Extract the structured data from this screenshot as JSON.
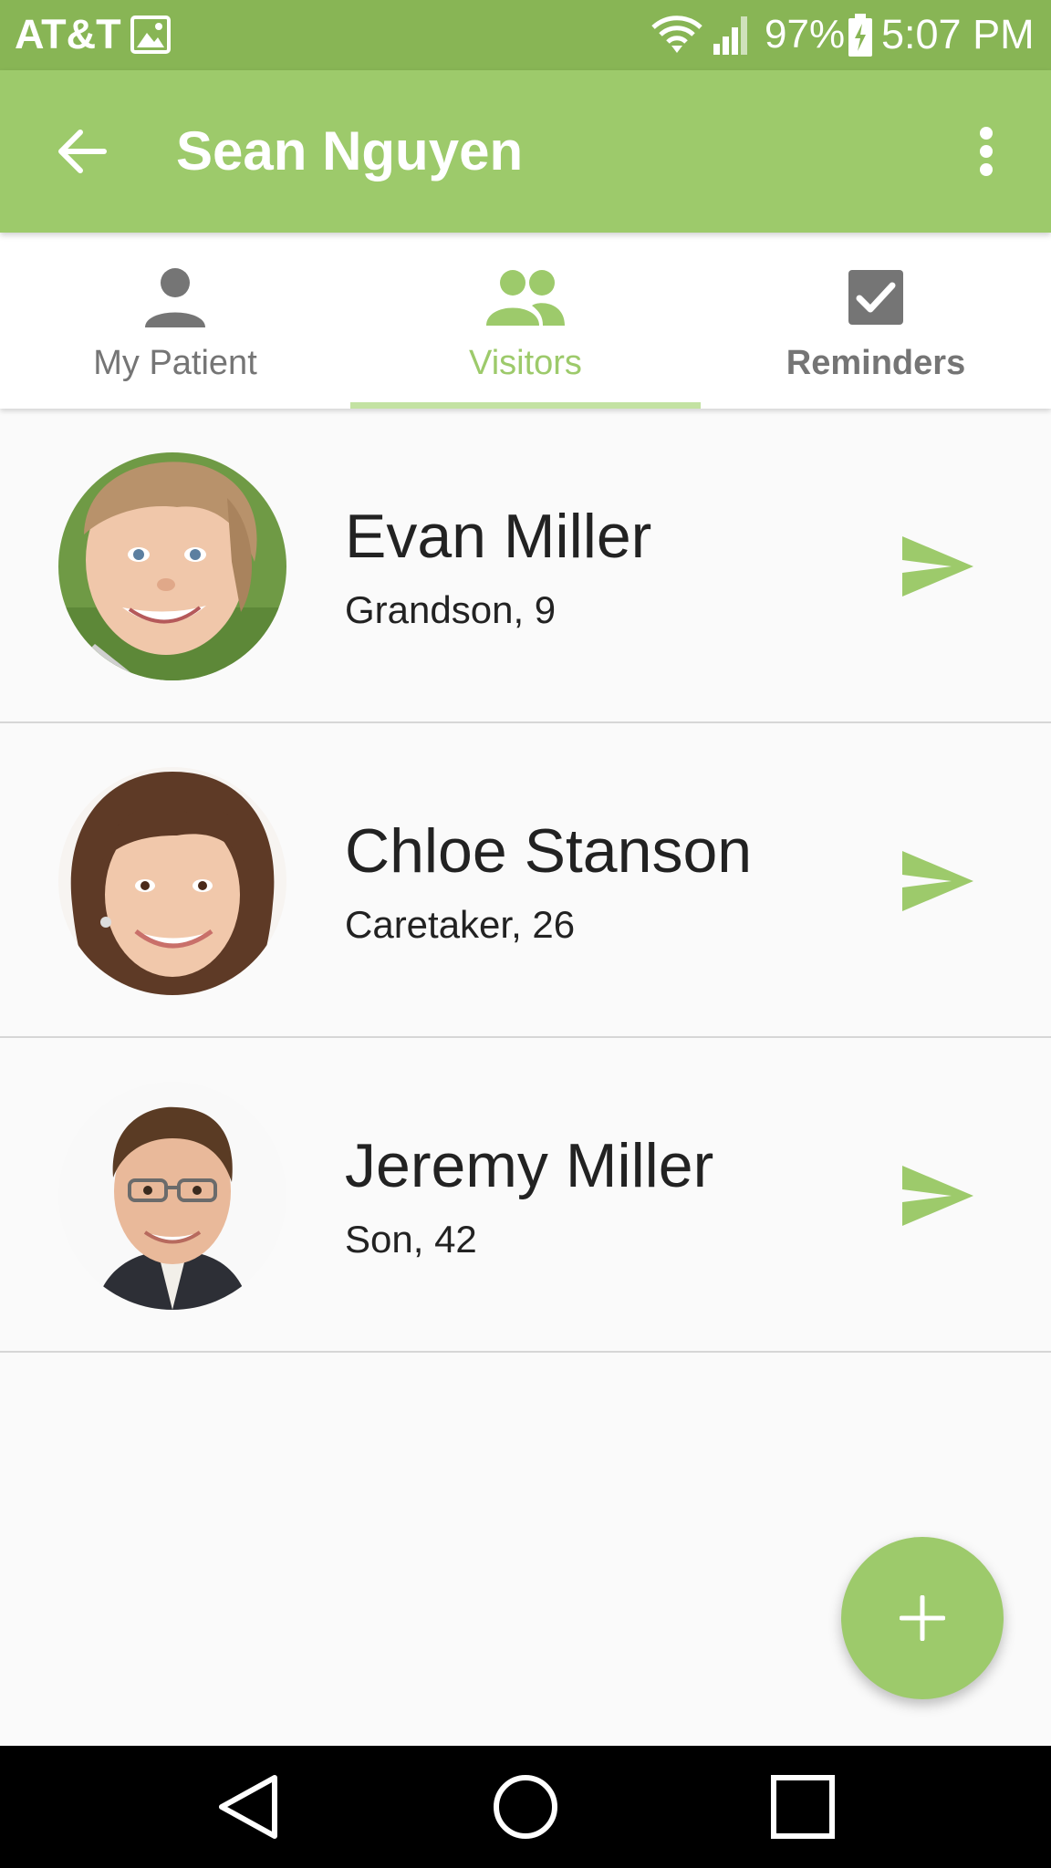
{
  "status_bar": {
    "carrier": "AT&T",
    "battery": "97%",
    "time": "5:07 PM",
    "icons": [
      "gallery-icon",
      "wifi-icon",
      "signal-icon",
      "battery-charging-icon"
    ]
  },
  "app_bar": {
    "title": "Sean Nguyen",
    "back_icon": "arrow-back-icon",
    "menu_icon": "more-vert-icon"
  },
  "tabs": [
    {
      "label": "My Patient",
      "icon": "person-icon",
      "active": false
    },
    {
      "label": "Visitors",
      "icon": "people-icon",
      "active": true
    },
    {
      "label": "Reminders",
      "icon": "checkbox-icon",
      "active": false
    }
  ],
  "visitors": [
    {
      "name": "Evan Miller",
      "detail": "Grandson, 9",
      "avatar": "child-photo"
    },
    {
      "name": "Chloe Stanson",
      "detail": "Caretaker, 26",
      "avatar": "woman-photo"
    },
    {
      "name": "Jeremy Miller",
      "detail": "Son, 42",
      "avatar": "man-photo"
    }
  ],
  "fab": {
    "icon": "plus-icon"
  },
  "nav_bar": {
    "icons": [
      "back-triangle-icon",
      "home-circle-icon",
      "recents-square-icon"
    ]
  },
  "colors": {
    "status_bar": "#88b555",
    "accent": "#9dca6b",
    "tab_indicator": "#c3e2a2",
    "inactive_tab": "#757575",
    "text_primary": "#222222"
  }
}
